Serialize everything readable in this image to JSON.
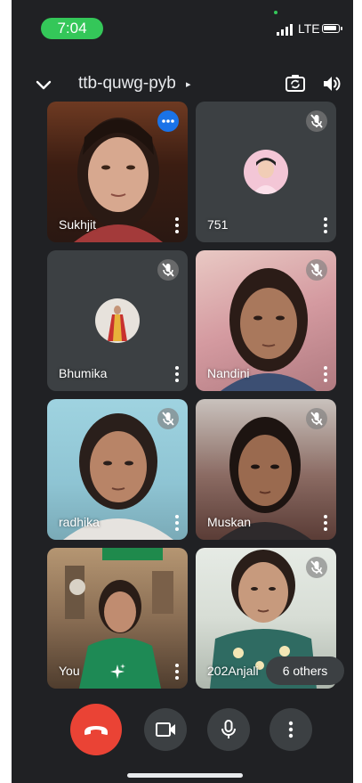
{
  "status_bar": {
    "time": "7:04",
    "network": "LTE"
  },
  "header": {
    "meeting_code": "ttb-quwg-pyb",
    "caret": "▸"
  },
  "participants": [
    {
      "name": "Sukhjit"
    },
    {
      "name": "751"
    },
    {
      "name": "Bhumika"
    },
    {
      "name": "Nandini"
    },
    {
      "name": "radhika"
    },
    {
      "name": "Muskan"
    },
    {
      "name": "You"
    },
    {
      "name": "202Anjali"
    }
  ],
  "others_label": "6 others",
  "colors": {
    "end_call": "#ea4335",
    "accent_blue": "#1a73e8",
    "status_green": "#34c759",
    "background": "#202124",
    "tile_bg": "#3c4043"
  }
}
